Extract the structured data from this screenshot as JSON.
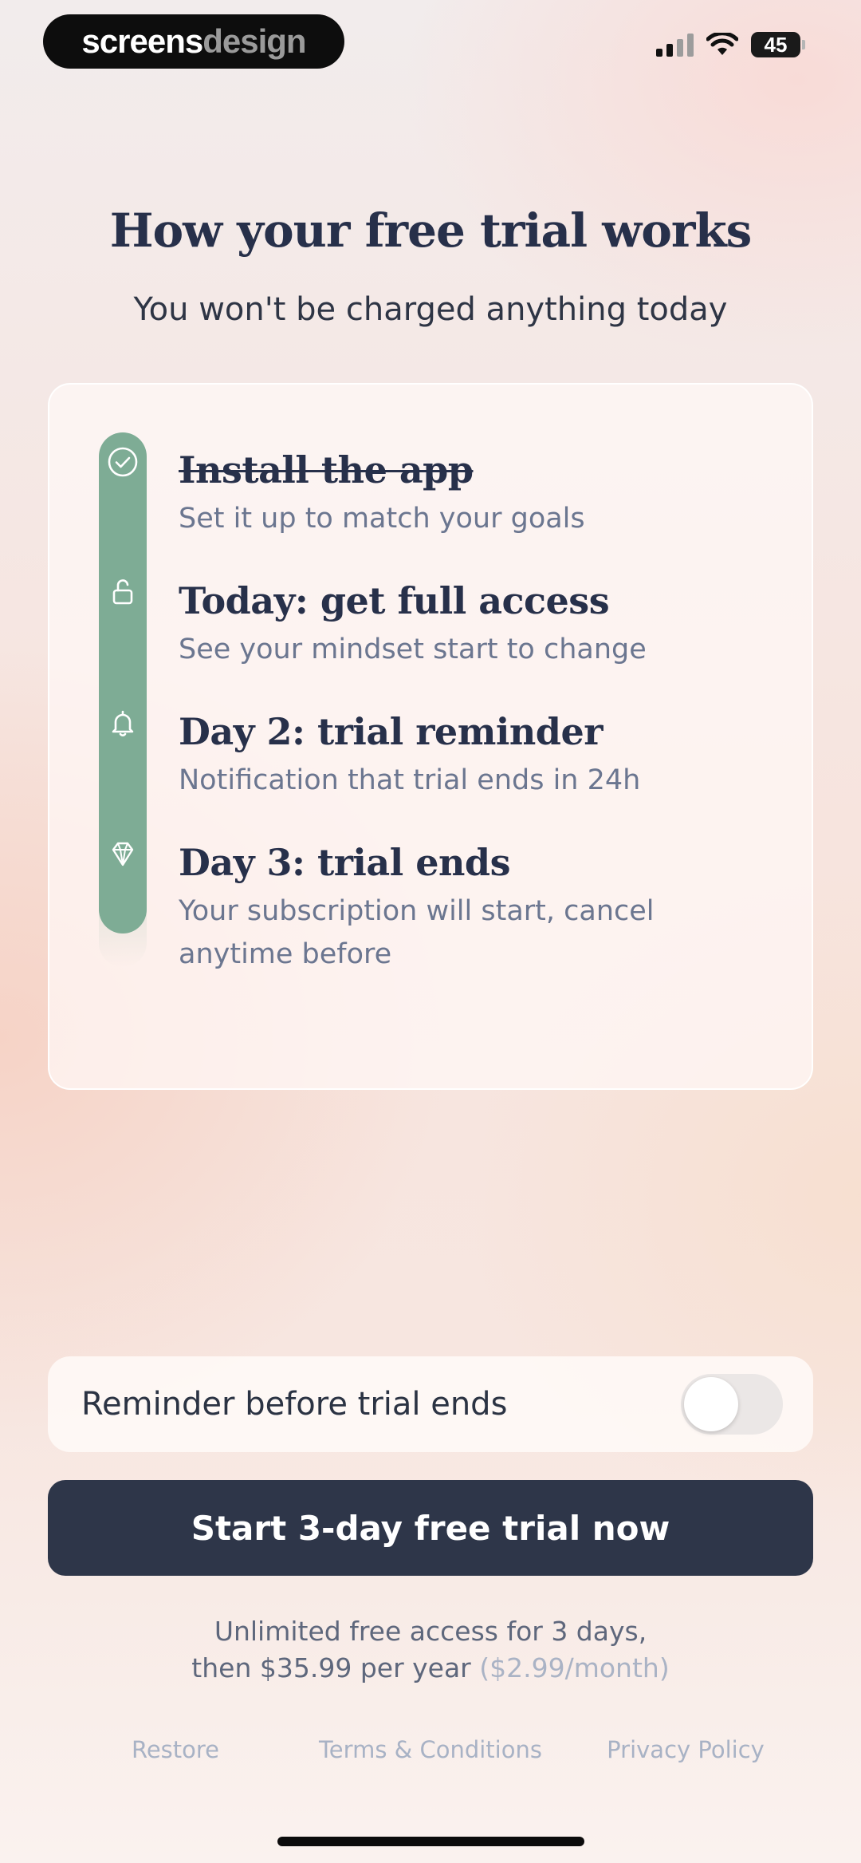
{
  "status_bar": {
    "brand_part1": "screens",
    "brand_part2": "design",
    "battery": "45"
  },
  "header": {
    "title": "How your free trial works",
    "subtitle": "You won't be charged anything today"
  },
  "timeline": {
    "steps": [
      {
        "title": "Install the app",
        "description": "Set it up to match your goals",
        "icon": "check-circle-icon",
        "completed": true
      },
      {
        "title": "Today: get full access",
        "description": "See your mindset start to change",
        "icon": "unlock-icon",
        "completed": false
      },
      {
        "title": "Day 2: trial reminder",
        "description": "Notification that trial ends in 24h",
        "icon": "bell-icon",
        "completed": false
      },
      {
        "title": "Day 3: trial ends",
        "description": "Your subscription will start, cancel anytime before",
        "icon": "diamond-icon",
        "completed": false
      }
    ],
    "rail_color": "#7eac95"
  },
  "reminder": {
    "label": "Reminder before trial ends",
    "enabled": false
  },
  "cta": {
    "label": "Start 3-day free trial now",
    "color": "#2e3649"
  },
  "pricing": {
    "line1": "Unlimited free access for 3 days,",
    "line2": "then $35.99 per year",
    "line2_muted": "($2.99/month)"
  },
  "footer": {
    "restore": "Restore",
    "terms": "Terms & Conditions",
    "privacy": "Privacy Policy"
  }
}
